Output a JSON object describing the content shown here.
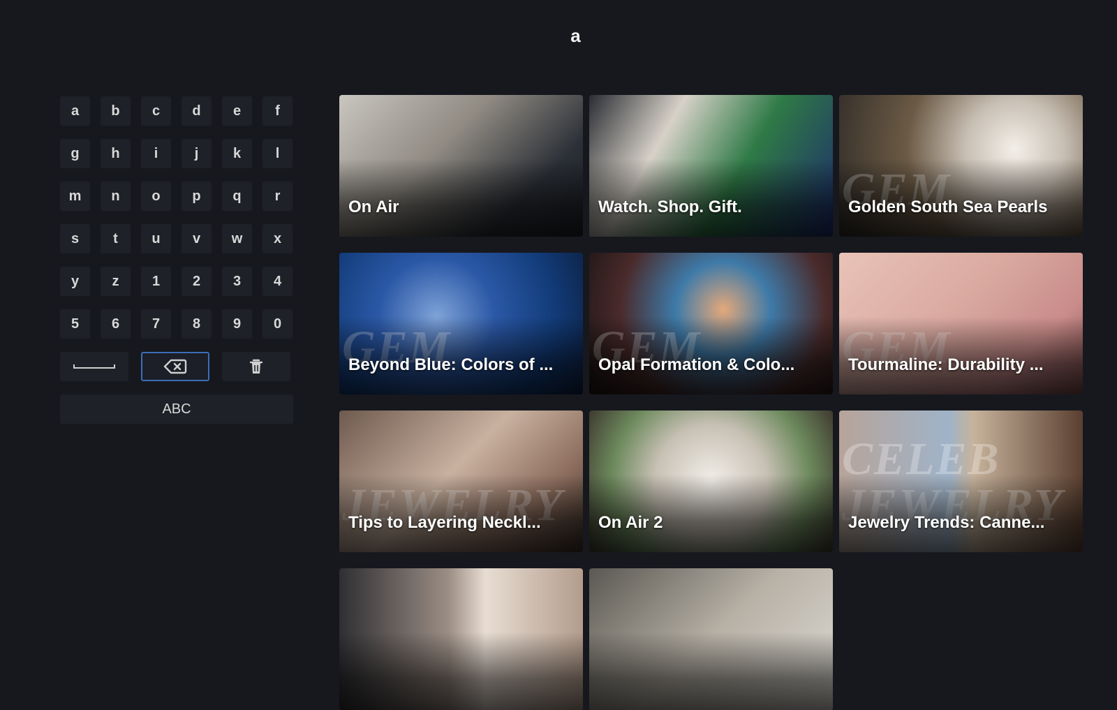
{
  "search": {
    "query": "a"
  },
  "keyboard": {
    "keys": [
      "a",
      "b",
      "c",
      "d",
      "e",
      "f",
      "g",
      "h",
      "i",
      "j",
      "k",
      "l",
      "m",
      "n",
      "o",
      "p",
      "q",
      "r",
      "s",
      "t",
      "u",
      "v",
      "w",
      "x",
      "y",
      "z",
      "1",
      "2",
      "3",
      "4",
      "5",
      "6",
      "7",
      "8",
      "9",
      "0"
    ],
    "space_icon": "space-bar-icon",
    "backspace_icon": "backspace-icon",
    "clear_icon": "trash-icon",
    "mode_label": "ABC",
    "focus_color": "#3d6db8"
  },
  "results": [
    {
      "title": "On Air",
      "watermark": ""
    },
    {
      "title": "Watch. Shop. Gift.",
      "watermark": ""
    },
    {
      "title": "Golden South Sea Pearls",
      "watermark": "GEM"
    },
    {
      "title": "Beyond Blue: Colors of ...",
      "watermark": "GEM"
    },
    {
      "title": "Opal Formation & Colo...",
      "watermark": "GEM"
    },
    {
      "title": "Tourmaline: Durability ...",
      "watermark": "GEM"
    },
    {
      "title": "Tips to Layering Neckl...",
      "watermark": "JEWELRY"
    },
    {
      "title": "On Air 2",
      "watermark": ""
    },
    {
      "title": "Jewelry Trends: Canne...",
      "watermark": "CELEB JEWELRY"
    },
    {
      "title": "",
      "watermark": ""
    },
    {
      "title": "",
      "watermark": ""
    }
  ]
}
